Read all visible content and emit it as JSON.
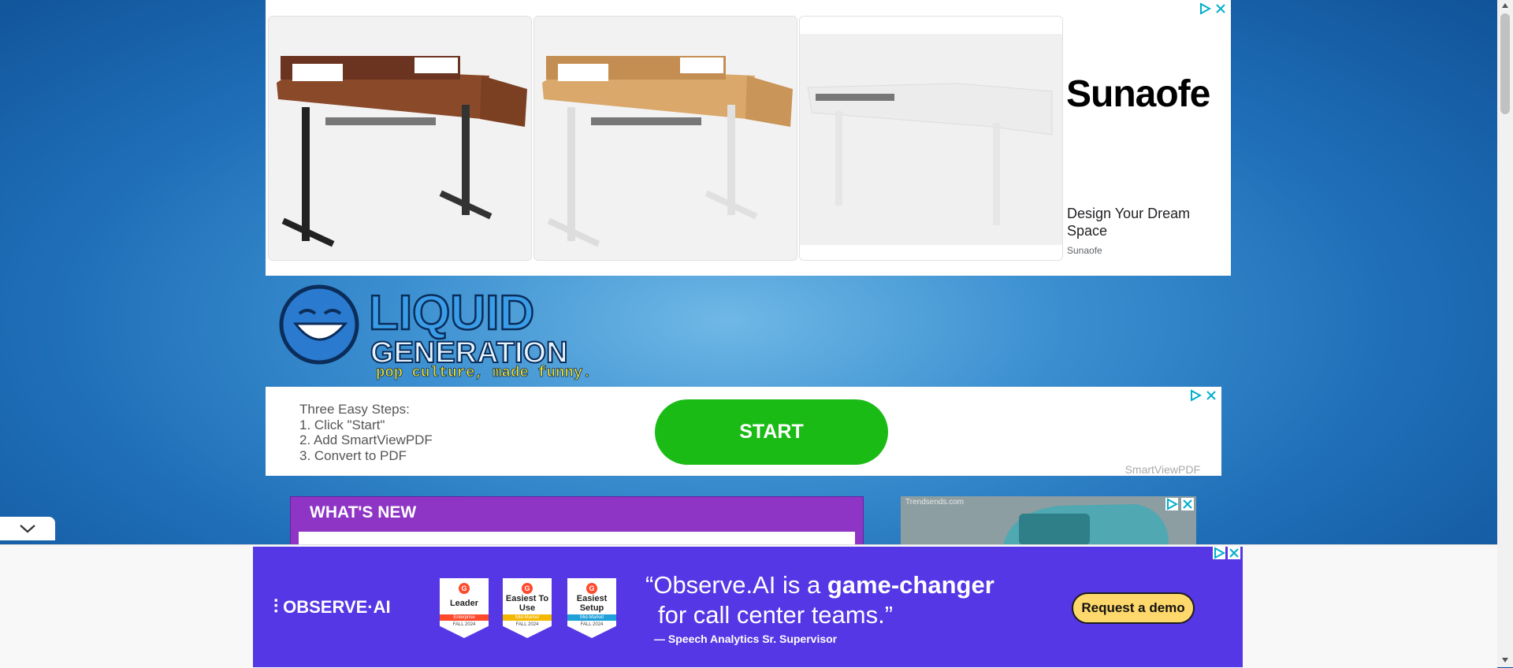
{
  "top_ad": {
    "brand": "Sunaofe",
    "headline": "Design Your Dream Space",
    "advertiser": "Sunaofe"
  },
  "logo": {
    "line1": "LIQUID",
    "line2": "GENERATION",
    "tagline": "pop culture, made funny."
  },
  "mid_ad": {
    "steps_title": "Three Easy Steps:",
    "step1": "1. Click \"Start\"",
    "step2": "2. Add SmartViewPDF",
    "step3": "3. Convert to PDF",
    "start_label": "START",
    "advertiser": "SmartViewPDF"
  },
  "whats_new": {
    "title": "WHAT'S NEW"
  },
  "side_ad": {
    "source": "Trendsends.com"
  },
  "bottom_ad": {
    "brand": "OBSERVE·AI",
    "badges": [
      {
        "top": "Leader",
        "band": "Enterprise",
        "season": "FALL 2024",
        "band_color": "#ff492c"
      },
      {
        "top": "Easiest To Use",
        "band": "Mid-Market",
        "season": "FALL 2024",
        "band_color": "#f5b800"
      },
      {
        "top": "Easiest Setup",
        "band": "Mid-Market",
        "season": "FALL 2024",
        "band_color": "#1ea0d8"
      }
    ],
    "quote_part1": "Observe.AI is a ",
    "quote_bold": "game-changer",
    "quote_part2": "for call center teams.”",
    "attribution": "— Speech Analytics Sr. Supervisor",
    "cta": "Request a demo"
  },
  "colors": {
    "start_green": "#1bbb16",
    "whats_new_purple": "#8e35c6",
    "observe_purple": "#5537e5",
    "cta_yellow": "#ffd86b"
  }
}
